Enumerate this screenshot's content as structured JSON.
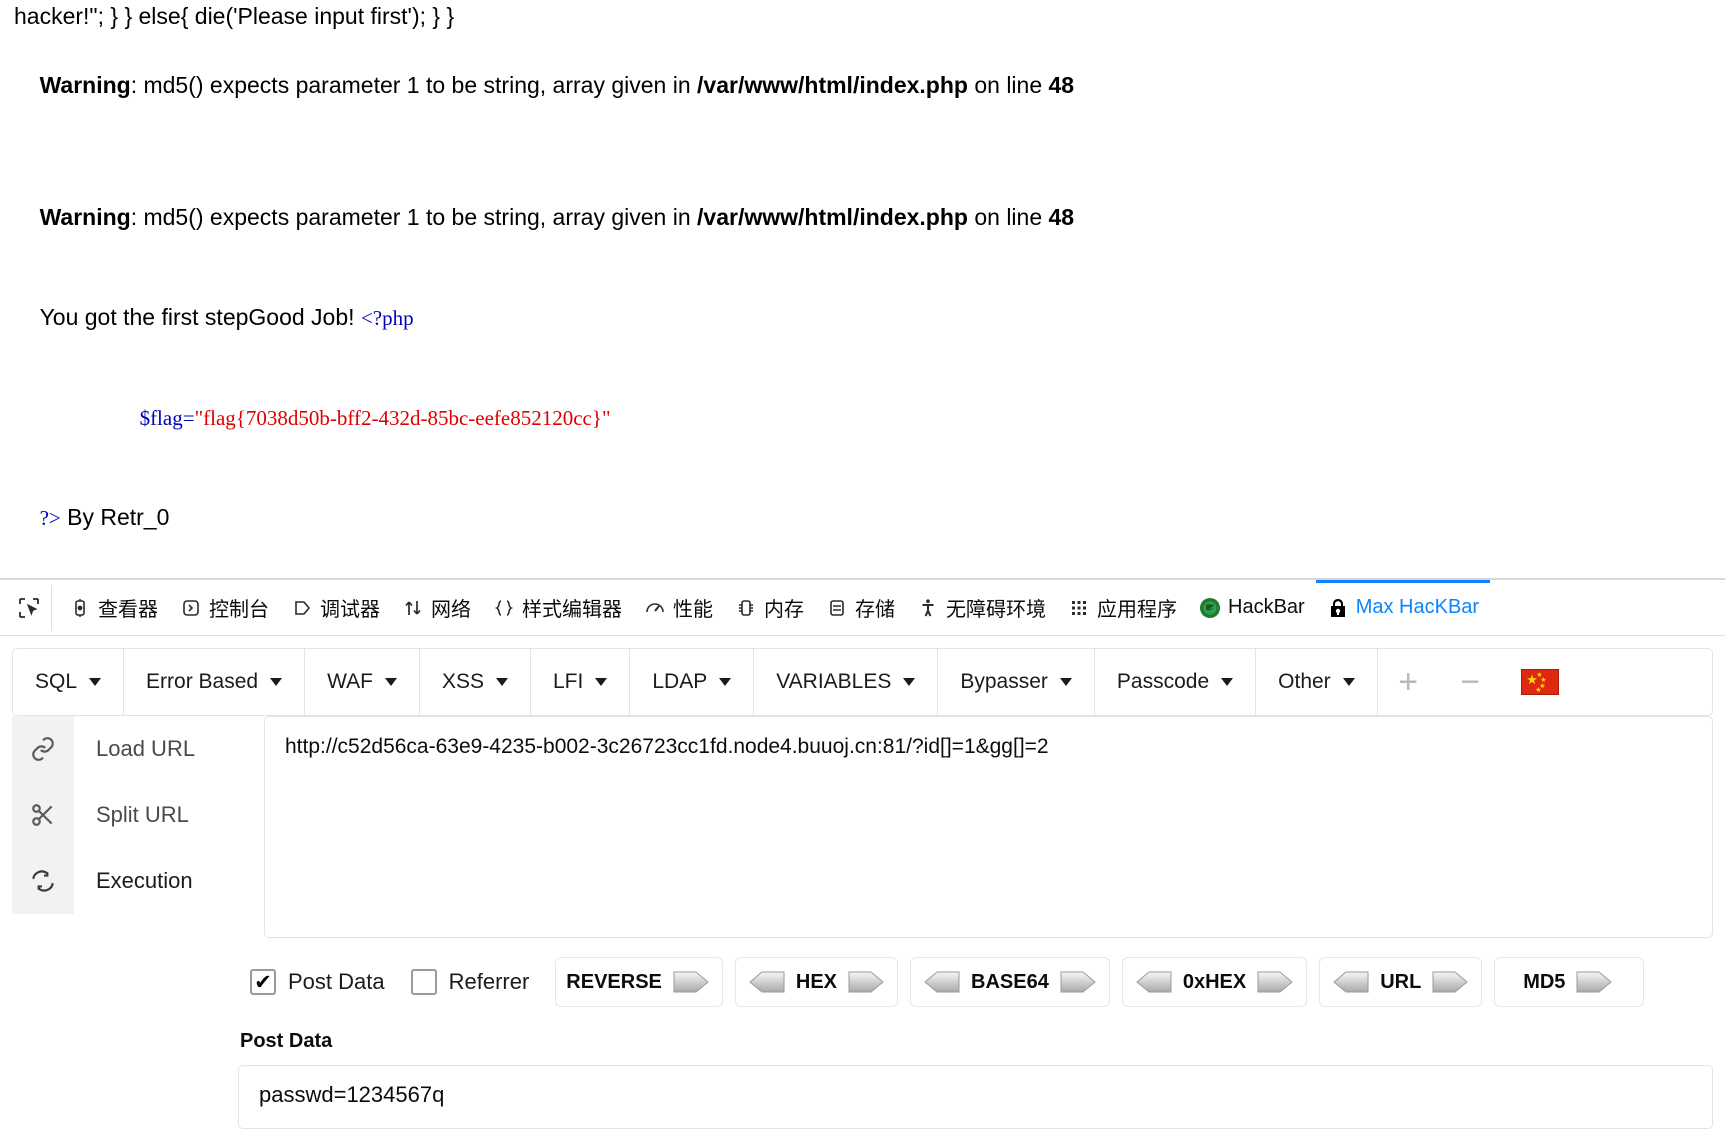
{
  "page": {
    "line1": "hacker!\"; } } else{ die('Please input first'); } }",
    "warning1": {
      "label": "Warning",
      "text": ": md5() expects parameter 1 to be string, array given in ",
      "file": "/var/www/html/index.php",
      "online": " on line ",
      "lineno": "48"
    },
    "warning2": {
      "label": "Warning",
      "text": ": md5() expects parameter 1 to be string, array given in ",
      "file": "/var/www/html/index.php",
      "online": " on line ",
      "lineno": "48"
    },
    "result_text": "You got the first stepGood Job! ",
    "php_open": "<?php",
    "php_var": "$flag=",
    "php_flag": "\"flag{7038d50b-bff2-432d-85bc-eefe852120cc}\"",
    "php_close": "?>",
    "signature": " By Retr_0"
  },
  "devtools": {
    "tabs": [
      {
        "label": "查看器",
        "icon": "inspector-icon",
        "selected": false
      },
      {
        "label": "控制台",
        "icon": "console-icon",
        "selected": false
      },
      {
        "label": "调试器",
        "icon": "debugger-icon",
        "selected": false
      },
      {
        "label": "网络",
        "icon": "network-icon",
        "selected": false
      },
      {
        "label": "样式编辑器",
        "icon": "style-editor-icon",
        "selected": false
      },
      {
        "label": "性能",
        "icon": "performance-icon",
        "selected": false
      },
      {
        "label": "内存",
        "icon": "memory-icon",
        "selected": false
      },
      {
        "label": "存储",
        "icon": "storage-icon",
        "selected": false
      },
      {
        "label": "无障碍环境",
        "icon": "accessibility-icon",
        "selected": false
      },
      {
        "label": "应用程序",
        "icon": "application-icon",
        "selected": false
      },
      {
        "label": "HackBar",
        "icon": "hackbar-icon",
        "selected": false
      },
      {
        "label": "Max HacKBar",
        "icon": "lock-icon",
        "selected": true
      }
    ],
    "selected_tab_color": "#0a84ff",
    "picker_icon": "element-picker-icon"
  },
  "hackbar": {
    "dropdowns": [
      {
        "label": "SQL"
      },
      {
        "label": "Error Based"
      },
      {
        "label": "WAF"
      },
      {
        "label": "XSS"
      },
      {
        "label": "LFI"
      },
      {
        "label": "LDAP"
      },
      {
        "label": "VARIABLES"
      },
      {
        "label": "Bypasser"
      },
      {
        "label": "Passcode"
      },
      {
        "label": "Other"
      }
    ],
    "add_label": "+",
    "remove_label": "−",
    "flag_icon": "china-flag-icon",
    "actions": [
      {
        "label": "Load URL",
        "icon": "link-icon"
      },
      {
        "label": "Split URL",
        "icon": "scissors-icon"
      },
      {
        "label": "Execution",
        "icon": "refresh-icon"
      }
    ],
    "url_value": "http://c52d56ca-63e9-4235-b002-3c26723cc1fd.node4.buuoj.cn:81/?id[]=1&gg[]=2",
    "post_data_checkbox": {
      "label": "Post Data",
      "checked": true,
      "mark": "✔"
    },
    "referrer_checkbox": {
      "label": "Referrer",
      "checked": false,
      "mark": ""
    },
    "encoders": [
      {
        "label": "REVERSE",
        "left_arrow": false,
        "right_arrow": true
      },
      {
        "label": "HEX",
        "left_arrow": true,
        "right_arrow": true
      },
      {
        "label": "BASE64",
        "left_arrow": true,
        "right_arrow": true
      },
      {
        "label": "0xHEX",
        "left_arrow": true,
        "right_arrow": true
      },
      {
        "label": "URL",
        "left_arrow": true,
        "right_arrow": true
      },
      {
        "label": "MD5",
        "left_arrow": false,
        "right_arrow": true
      }
    ],
    "post_data_label": "Post Data",
    "post_data_value": "passwd=1234567q"
  }
}
